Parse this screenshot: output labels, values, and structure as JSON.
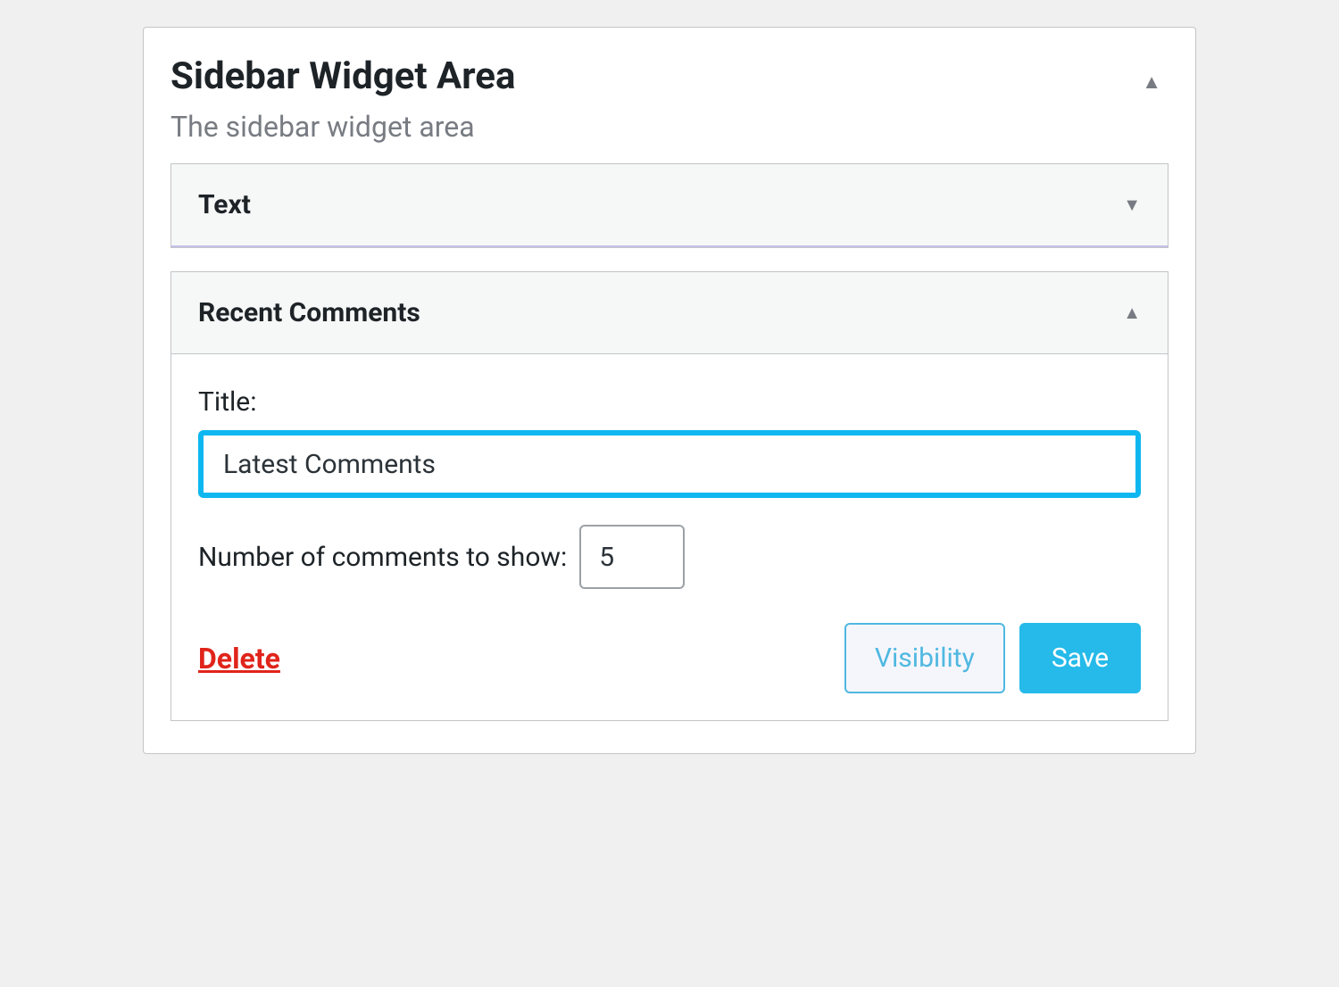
{
  "panel": {
    "title": "Sidebar Widget Area",
    "subtitle": "The sidebar widget area"
  },
  "widgets": {
    "text": {
      "label": "Text"
    },
    "recent_comments": {
      "label": "Recent Comments",
      "title_label": "Title:",
      "title_value": "Latest Comments",
      "count_label": "Number of comments to show:",
      "count_value": "5",
      "delete_label": "Delete",
      "visibility_label": "Visibility",
      "save_label": "Save"
    }
  }
}
